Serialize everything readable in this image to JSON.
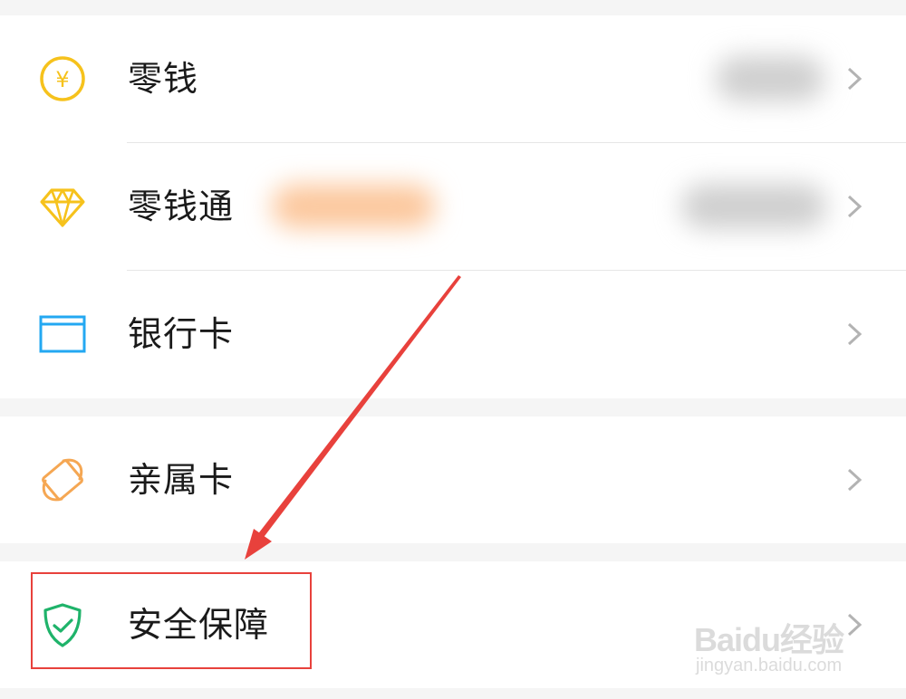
{
  "rows": [
    {
      "label": "零钱",
      "icon": "yuan-coin-icon"
    },
    {
      "label": "零钱通",
      "icon": "diamond-icon"
    },
    {
      "label": "银行卡",
      "icon": "bank-card-icon"
    },
    {
      "label": "亲属卡",
      "icon": "family-card-icon"
    },
    {
      "label": "安全保障",
      "icon": "shield-check-icon"
    }
  ],
  "icons": {
    "yuan_symbol": "¥"
  },
  "watermark": {
    "logo": "Baidu经验",
    "site": "jingyan.baidu.com"
  },
  "colors": {
    "yuan": "#f6c21c",
    "diamond": "#f6c21c",
    "bank_card": "#23a8f2",
    "family_card": "#f5a753",
    "shield": "#1fb36a",
    "highlight": "#e8413c",
    "arrow": "#e8413c",
    "chevron": "#b3b3b3"
  }
}
